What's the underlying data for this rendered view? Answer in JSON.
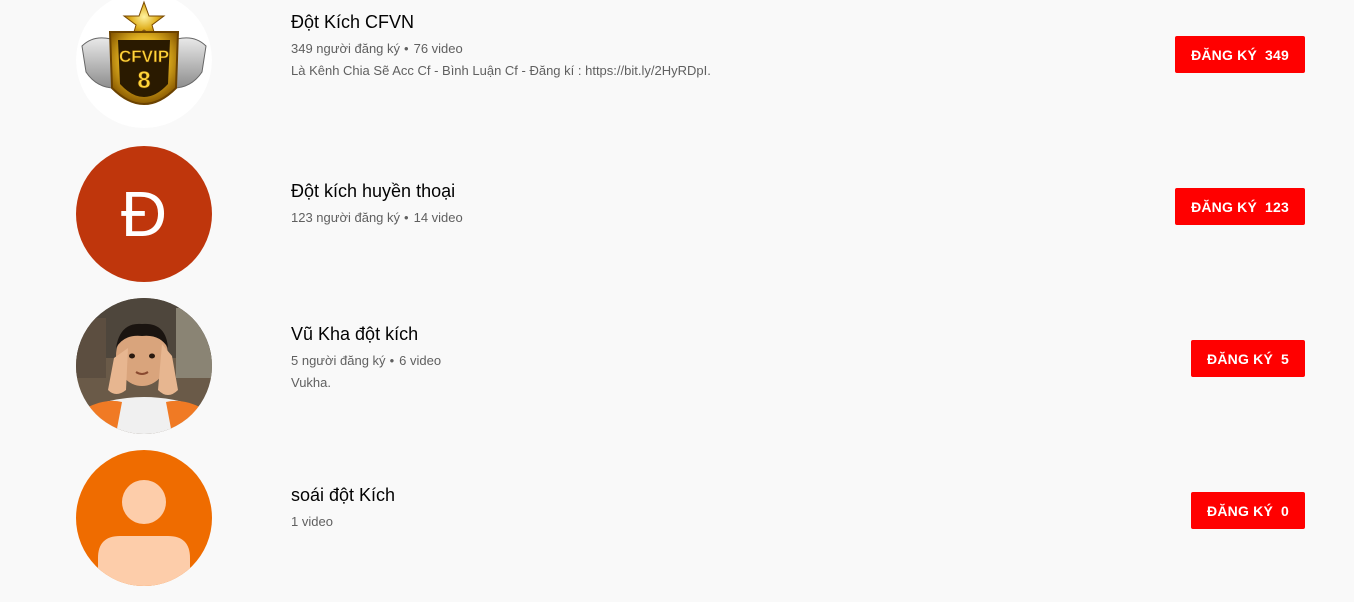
{
  "colors": {
    "background": "#f9f9f9",
    "subscribe_button": "#ff0000",
    "title_text": "#030303",
    "meta_text": "#606060"
  },
  "channels": [
    {
      "name": "Đột Kích CFVN",
      "subscribers": "349 người đăng ký",
      "videos": "76 video",
      "description": "Là Kênh Chia Sẽ Acc Cf - Bình Luận Cf - Đăng kí : https://bit.ly/2HyRDpI.",
      "avatar_icon": "cfvip-8-badge-logo",
      "avatar_text_top": "CFVIP",
      "avatar_text_bottom": "8",
      "button_label": "ĐĂNG KÝ",
      "button_count": "349"
    },
    {
      "name": "Đột kích huyền thoại",
      "subscribers": "123 người đăng ký",
      "videos": "14 video",
      "avatar_icon": "letter-avatar",
      "avatar_letter": "Đ",
      "avatar_color": "#bf360c",
      "button_label": "ĐĂNG KÝ",
      "button_count": "123"
    },
    {
      "name": "Vũ Kha đột kích",
      "subscribers": "5 người đăng ký",
      "videos": "6 video",
      "description": "Vukha.",
      "avatar_icon": "child-photo-avatar",
      "button_label": "ĐĂNG KÝ",
      "button_count": "5"
    },
    {
      "name": "soái đột Kích",
      "videos": "1 video",
      "avatar_icon": "default-person-avatar",
      "avatar_color": "#ef6c00",
      "button_label": "ĐĂNG KÝ",
      "button_count": "0"
    }
  ]
}
